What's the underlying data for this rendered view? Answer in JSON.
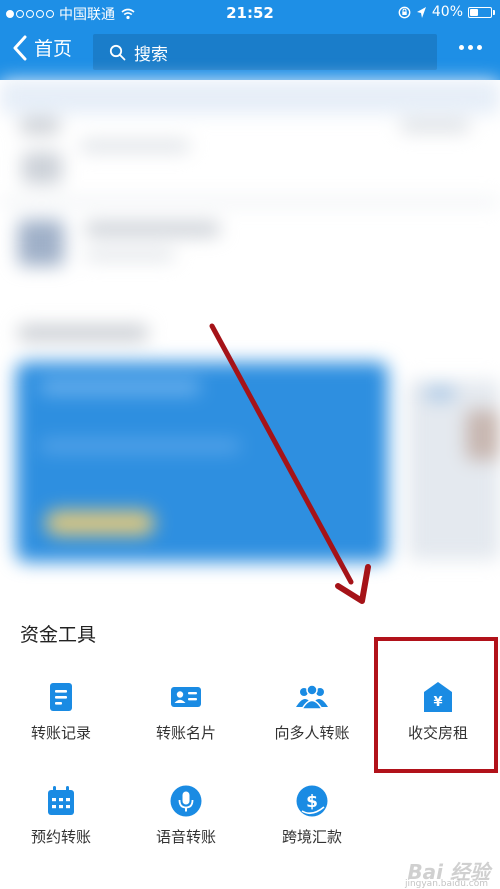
{
  "status_bar": {
    "carrier": "中国联通",
    "time": "21:52",
    "battery": "40%",
    "battery_level": 0.4
  },
  "nav": {
    "back_label": "首页",
    "search_placeholder": "搜索"
  },
  "fund_tools": {
    "title": "资金工具",
    "items": [
      {
        "label": "转账记录",
        "icon": "document-list-icon"
      },
      {
        "label": "转账名片",
        "icon": "contact-card-icon"
      },
      {
        "label": "向多人转账",
        "icon": "multi-user-icon"
      },
      {
        "label": "收交房租",
        "icon": "house-yuan-icon"
      },
      {
        "label": "预约转账",
        "icon": "calendar-icon"
      },
      {
        "label": "语音转账",
        "icon": "microphone-icon"
      },
      {
        "label": "跨境汇款",
        "icon": "dollar-coin-icon"
      }
    ]
  },
  "colors": {
    "header_blue": "#1e8fe6",
    "icon_blue": "#1a8be3",
    "annotation_red": "#b1121a"
  },
  "watermark": {
    "text": "Bai 经验",
    "sub": "jingyan.baidu.com"
  }
}
